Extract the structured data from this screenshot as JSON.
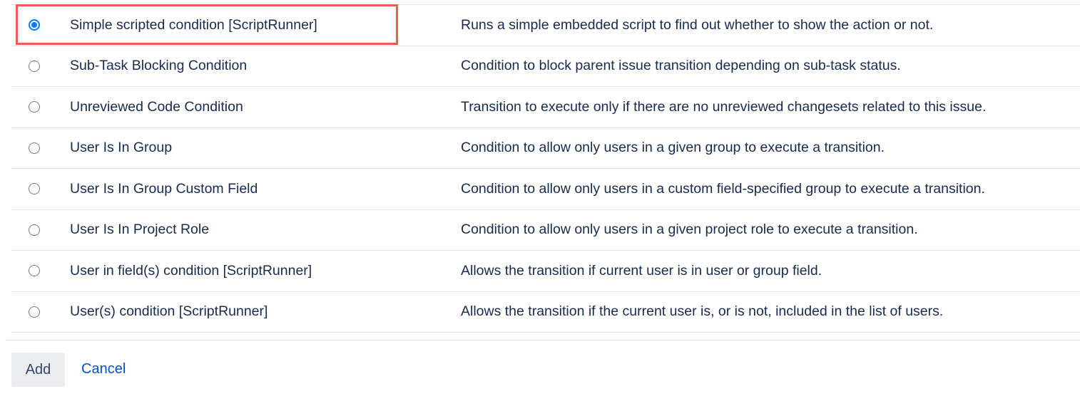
{
  "conditions": [
    {
      "name": "Simple scripted condition [ScriptRunner]",
      "description": "Runs a simple embedded script to find out whether to show the action or not.",
      "selected": true
    },
    {
      "name": "Sub-Task Blocking Condition",
      "description": "Condition to block parent issue transition depending on sub-task status.",
      "selected": false
    },
    {
      "name": "Unreviewed Code Condition",
      "description": "Transition to execute only if there are no unreviewed changesets related to this issue.",
      "selected": false
    },
    {
      "name": "User Is In Group",
      "description": "Condition to allow only users in a given group to execute a transition.",
      "selected": false
    },
    {
      "name": "User Is In Group Custom Field",
      "description": "Condition to allow only users in a custom field-specified group to execute a transition.",
      "selected": false
    },
    {
      "name": "User Is In Project Role",
      "description": "Condition to allow only users in a given project role to execute a transition.",
      "selected": false
    },
    {
      "name": "User in field(s) condition [ScriptRunner]",
      "description": "Allows the transition if current user is in user or group field.",
      "selected": false
    },
    {
      "name": "User(s) condition [ScriptRunner]",
      "description": "Allows the transition if the current user is, or is not, included in the list of users.",
      "selected": false
    }
  ],
  "footer": {
    "add_label": "Add",
    "cancel_label": "Cancel"
  },
  "colors": {
    "highlight": "#f15b50",
    "radio_selected": "#0a7cff",
    "link": "#0052cc",
    "text": "#172b4d"
  }
}
